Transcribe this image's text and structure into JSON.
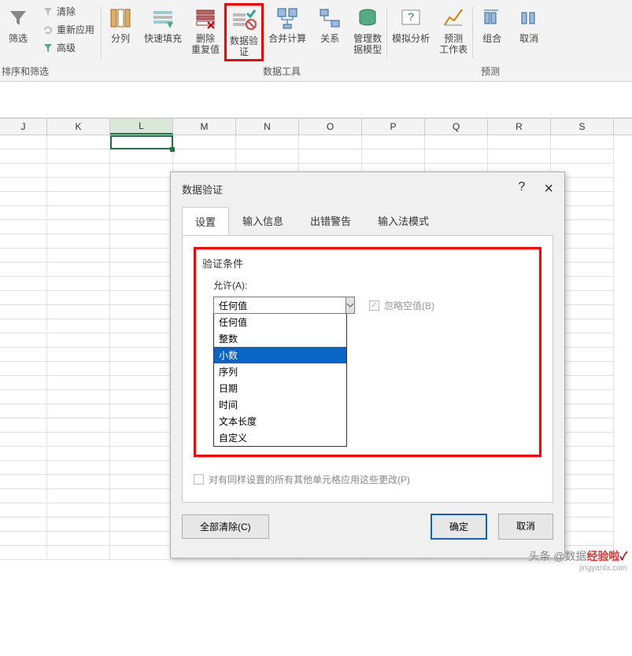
{
  "ribbon": {
    "small_left": {
      "filter_label": "筛选",
      "sort_label": "排序和筛选",
      "clear": "清除",
      "reapply": "重新应用",
      "advanced": "高级"
    },
    "buttons": {
      "text_to_columns": "分列",
      "flash_fill": "快速填充",
      "remove_duplicates": "删除\n重复值",
      "data_validation": "数据验\n证",
      "consolidate": "合并计算",
      "relationships": "关系",
      "data_model": "管理数\n据模型",
      "what_if": "模拟分析",
      "forecast": "预测\n工作表",
      "group": "组合",
      "ungroup": "取消"
    },
    "group_labels": {
      "data_tools": "数据工具",
      "forecast": "预测"
    }
  },
  "columns": [
    "J",
    "K",
    "L",
    "M",
    "N",
    "O",
    "P",
    "Q",
    "R",
    "S"
  ],
  "dialog": {
    "title": "数据验证",
    "help": "?",
    "close": "×",
    "tabs": {
      "settings": "设置",
      "input_message": "输入信息",
      "error_alert": "出错警告",
      "ime_mode": "输入法模式"
    },
    "validation_criteria": "验证条件",
    "allow_label": "允许(A):",
    "allow_value": "任何值",
    "ignore_blank": "忽略空值(B)",
    "options": [
      "任何值",
      "整数",
      "小数",
      "序列",
      "日期",
      "时间",
      "文本长度",
      "自定义"
    ],
    "selected_option": "小数",
    "apply_to_others": "对有同样设置的所有其他单元格应用这些更改(P)",
    "clear_all": "全部清除(C)",
    "ok": "确定",
    "cancel": "取消"
  },
  "watermark": {
    "prefix": "头条 @数据",
    "brand": "经验啦",
    "check": "✓",
    "url": "jingyanla.com"
  }
}
